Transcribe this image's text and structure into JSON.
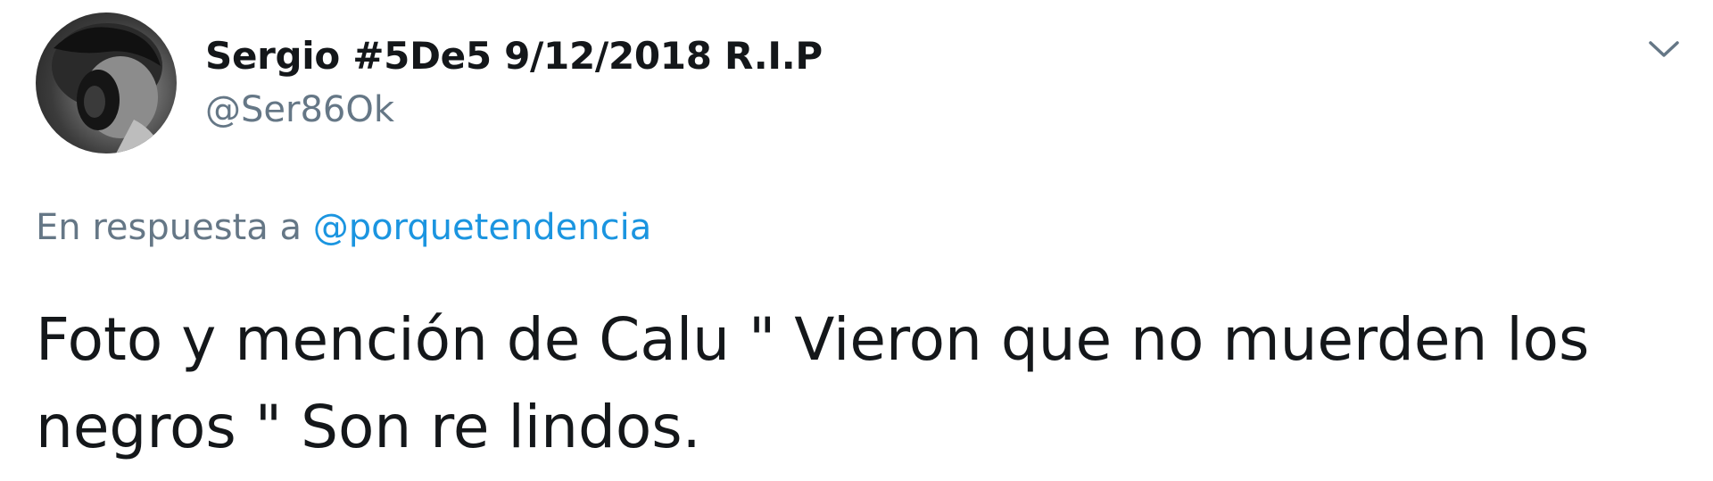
{
  "tweet": {
    "author": {
      "display_name": "Sergio #5De5 9/12/2018 R.I.P",
      "handle": "@Ser86Ok",
      "avatar_icon": "profile-photo"
    },
    "menu_icon": "chevron-down-icon",
    "reply_context": {
      "prefix": "En respuesta a",
      "mention": "@porquetendencia"
    },
    "text": "Foto y mención de Calu \" Vieron que no muerden los negros \" Son re lindos.",
    "colors": {
      "text": "#14171a",
      "secondary": "#657786",
      "link": "#1b95e0"
    }
  }
}
